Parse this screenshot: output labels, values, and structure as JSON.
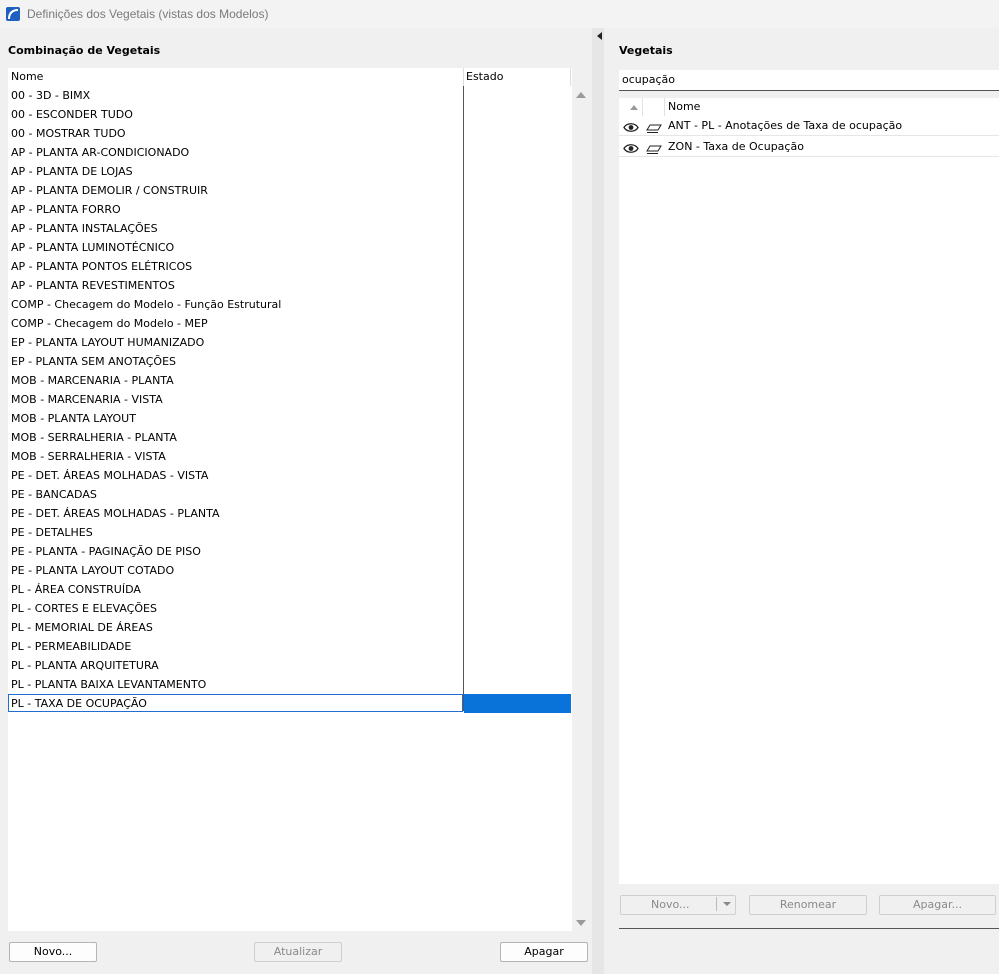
{
  "window": {
    "title": "Definições dos Vegetais (vistas dos Modelos)"
  },
  "left": {
    "title": "Combinação de Vegetais",
    "columns": {
      "name": "Nome",
      "state": "Estado"
    },
    "items": [
      "00 - 3D - BIMX",
      "00 - ESCONDER TUDO",
      "00 - MOSTRAR TUDO",
      "AP - PLANTA AR-CONDICIONADO",
      "AP - PLANTA DE LOJAS",
      "AP - PLANTA DEMOLIR / CONSTRUIR",
      "AP - PLANTA FORRO",
      "AP - PLANTA INSTALAÇÕES",
      "AP - PLANTA LUMINOTÉCNICO",
      "AP - PLANTA PONTOS ELÉTRICOS",
      "AP - PLANTA REVESTIMENTOS",
      "COMP - Checagem do Modelo - Função Estrutural",
      "COMP - Checagem do Modelo - MEP",
      "EP - PLANTA LAYOUT HUMANIZADO",
      "EP - PLANTA SEM ANOTAÇÕES",
      "MOB - MARCENARIA - PLANTA",
      "MOB - MARCENARIA - VISTA",
      "MOB - PLANTA LAYOUT",
      "MOB - SERRALHERIA - PLANTA",
      "MOB - SERRALHERIA - VISTA",
      "PE  - DET. ÁREAS MOLHADAS - VISTA",
      "PE - BANCADAS",
      "PE - DET. ÁREAS MOLHADAS - PLANTA",
      "PE - DETALHES",
      "PE - PLANTA - PAGINAÇÃO DE PISO",
      "PE - PLANTA LAYOUT COTADO",
      "PL - ÁREA CONSTRUÍDA",
      "PL - CORTES E ELEVAÇÕES",
      "PL - MEMORIAL DE ÁREAS",
      "PL - PERMEABILIDADE",
      "PL - PLANTA ARQUITETURA",
      "PL - PLANTA BAIXA LEVANTAMENTO",
      "PL - TAXA DE OCUPAÇÃO"
    ],
    "selected_index": 32,
    "buttons": {
      "new": "Novo...",
      "update": "Atualizar",
      "delete": "Apagar"
    }
  },
  "right": {
    "title": "Vegetais",
    "search_value": "ocupação",
    "column_name": "Nome",
    "items": [
      {
        "name": "ANT - PL - Anotações de Taxa de ocupação",
        "icons": [
          "eye-icon",
          "layer-icon"
        ]
      },
      {
        "name": "ZON - Taxa de Ocupação",
        "icons": [
          "eye-icon",
          "layer-icon"
        ]
      }
    ],
    "buttons": {
      "new": "Novo...",
      "rename": "Renomear",
      "delete": "Apagar..."
    }
  },
  "colors": {
    "selection": "#0a73d9",
    "app_icon": "#1f5fbf"
  }
}
